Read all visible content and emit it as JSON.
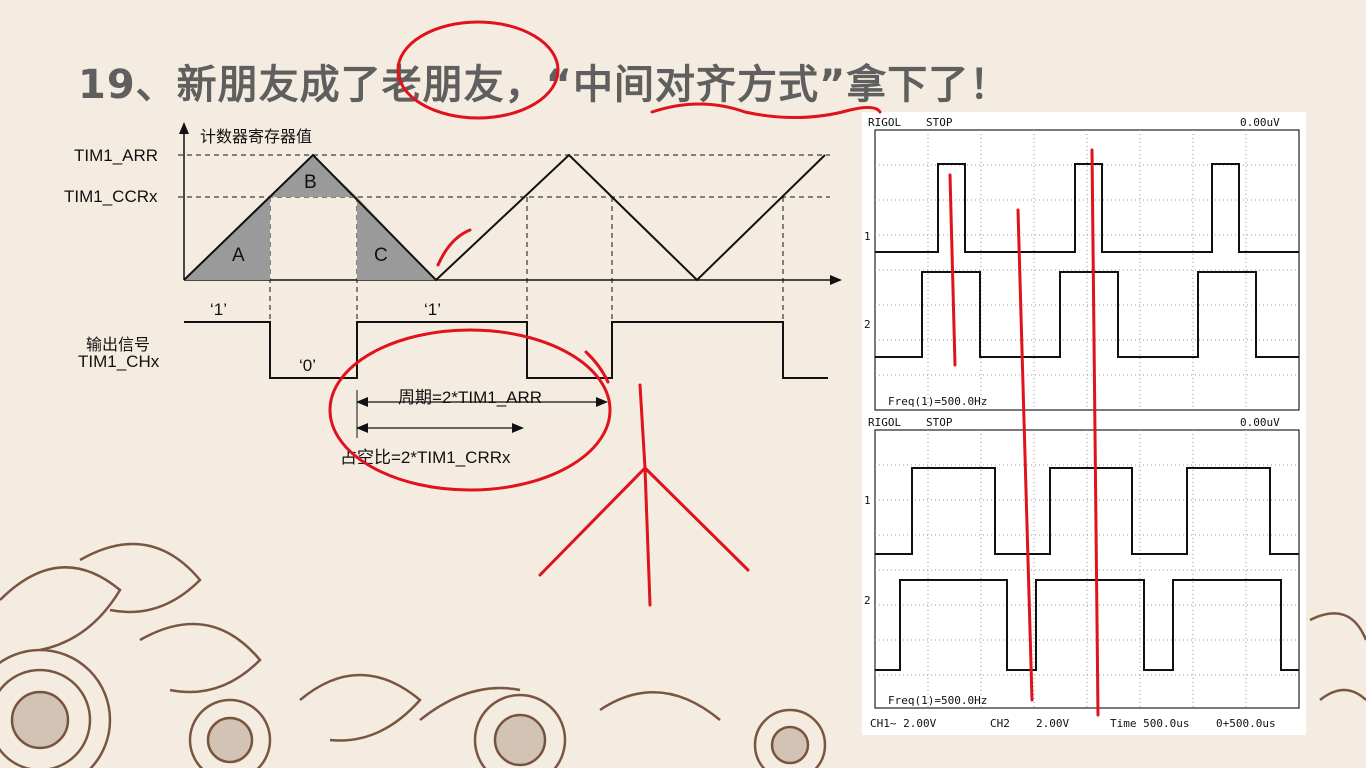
{
  "slide": {
    "title": "19、新朋友成了老朋友，“中间对齐方式”拿下了！"
  },
  "timing_diagram": {
    "y_axis_label": "计数器寄存器值",
    "arr_label": "TIM1_ARR",
    "ccr_label": "TIM1_CCRx",
    "region_a": "A",
    "region_b": "B",
    "region_c": "C",
    "level_high_1": "‘1’",
    "level_high_2": "‘1’",
    "level_low": "‘0’",
    "output_label_line1": "输出信号",
    "output_label_line2": "TIM1_CHx",
    "period_label": "周期=2*TIM1_ARR",
    "duty_label": "占空比=2*TIM1_CRRx"
  },
  "oscilloscope_top": {
    "brand": "RIGOL",
    "state": "STOP",
    "trigger_readout": "0.00uV",
    "ch1_marker": "1",
    "ch2_marker": "2",
    "freq_readout": "Freq(1)=500.0Hz"
  },
  "oscilloscope_bottom": {
    "brand": "RIGOL",
    "state": "STOP",
    "trigger_readout": "0.00uV",
    "ch1_marker": "1",
    "ch2_marker": "2",
    "freq_readout": "Freq(1)=500.0Hz",
    "ch1_scale": "CH1~ 2.00V",
    "ch2_name": "CH2",
    "ch2_scale": "2.00V",
    "time_base": "Time 500.0us",
    "trigger_offset": "0+500.0us"
  },
  "colors": {
    "annotation_ink": "#e0121b",
    "region_fill": "#9a9a9a",
    "background": "#f4ece0",
    "ornament": "#6b4630"
  }
}
